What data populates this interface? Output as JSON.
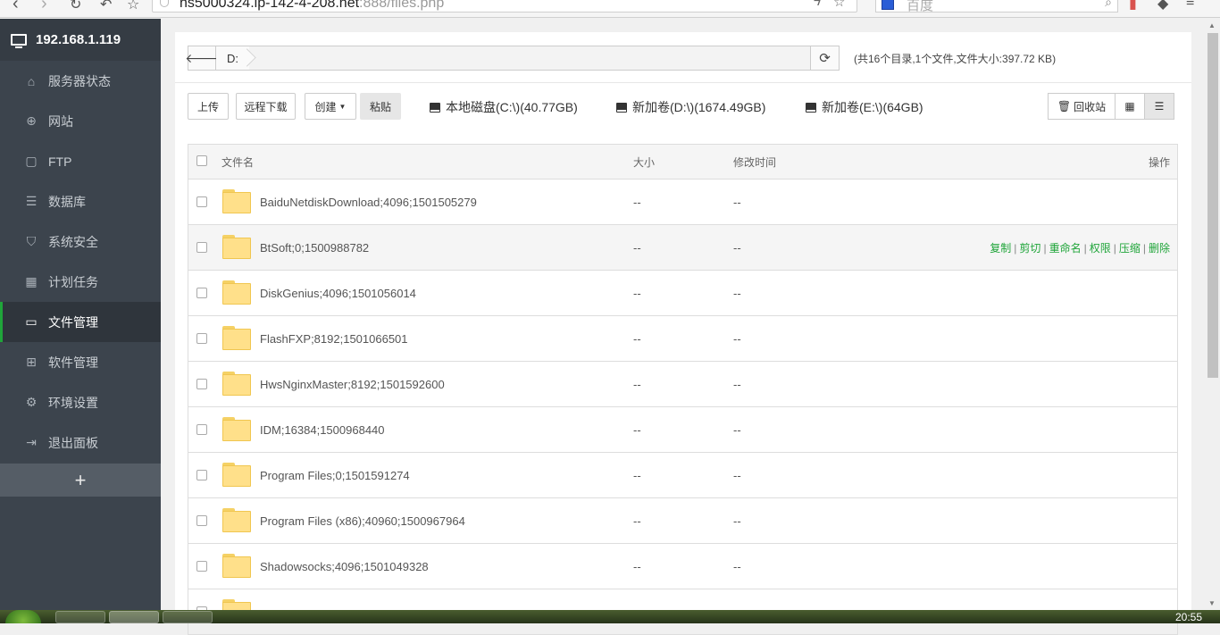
{
  "browser": {
    "url_main": "hs5000324.ip-142-4-208.net",
    "url_dim": ":888/files.php",
    "search_placeholder": "百度"
  },
  "sidebar": {
    "server_ip": "192.168.1.119",
    "items": [
      {
        "label": "服务器状态",
        "icon": "home-icon"
      },
      {
        "label": "网站",
        "icon": "globe-icon"
      },
      {
        "label": "FTP",
        "icon": "ftp-icon"
      },
      {
        "label": "数据库",
        "icon": "database-icon"
      },
      {
        "label": "系统安全",
        "icon": "shield-icon"
      },
      {
        "label": "计划任务",
        "icon": "calendar-icon"
      },
      {
        "label": "文件管理",
        "icon": "folder-icon",
        "active": true
      },
      {
        "label": "软件管理",
        "icon": "grid-icon"
      },
      {
        "label": "环境设置",
        "icon": "gear-icon"
      },
      {
        "label": "退出面板",
        "icon": "logout-icon"
      }
    ],
    "add_label": "+"
  },
  "pathbar": {
    "current": "D:",
    "summary": "(共16个目录,1个文件,文件大小:397.72 KB)"
  },
  "toolbar": {
    "upload": "上传",
    "remote_download": "远程下载",
    "create": "创建",
    "paste": "粘贴",
    "disks": [
      "本地磁盘(C:\\)(40.77GB)",
      "新加卷(D:\\)(1674.49GB)",
      "新加卷(E:\\)(64GB)"
    ],
    "recycle": "回收站"
  },
  "table": {
    "headers": {
      "name": "文件名",
      "size": "大小",
      "time": "修改时间",
      "ops": "操作"
    },
    "rows": [
      {
        "name": "BaiduNetdiskDownload;4096;1501505279",
        "size": "--",
        "time": "--"
      },
      {
        "name": "BtSoft;0;1500988782",
        "size": "--",
        "time": "--"
      },
      {
        "name": "DiskGenius;4096;1501056014",
        "size": "--",
        "time": "--"
      },
      {
        "name": "FlashFXP;8192;1501066501",
        "size": "--",
        "time": "--"
      },
      {
        "name": "HwsNginxMaster;8192;1501592600",
        "size": "--",
        "time": "--"
      },
      {
        "name": "IDM;16384;1500968440",
        "size": "--",
        "time": "--"
      },
      {
        "name": "Program Files;0;1501591274",
        "size": "--",
        "time": "--"
      },
      {
        "name": "Program Files (x86);40960;1500967964",
        "size": "--",
        "time": "--"
      },
      {
        "name": "Shadowsocks;4096;1501049328",
        "size": "--",
        "time": "--"
      }
    ],
    "row_actions": [
      "复制",
      "剪切",
      "重命名",
      "权限",
      "压缩",
      "删除"
    ]
  },
  "taskbar": {
    "clock": "20:55"
  },
  "colors": {
    "accent": "#20a53a",
    "sidebar_bg": "#3c444d"
  }
}
